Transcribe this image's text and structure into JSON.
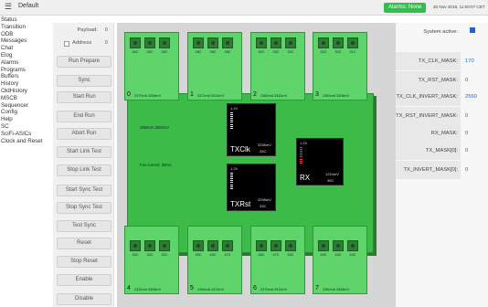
{
  "topbar": {
    "menu_icon": "hamburger-icon",
    "app_title": "Default",
    "alarms": "Alarms: None",
    "datetime": "20 Nov 2019, 11:00:07 CET"
  },
  "sidebar": {
    "items": [
      "Status",
      "Transition",
      "ODB",
      "Messages",
      "Chat",
      "Elog",
      "Alarms",
      "Programs",
      "Buffers",
      "History",
      "OldHistory",
      "MSCB",
      "Sequencer",
      "Config",
      "Help",
      "SC",
      "SciFi-ASICs",
      "Clock and Reset"
    ]
  },
  "controls": {
    "payload_label": "Payload:",
    "payload_value": "0",
    "address_label": "Address",
    "address_value": "0",
    "buttons": [
      "Run Prepare",
      "Sync",
      "Start Run",
      "End Run",
      "Abort Run",
      "Start Link Test",
      "Stop Link Test",
      "Start Sync Test",
      "Stop Sync Test",
      "Test Sync",
      "Reset",
      "Stop Reset",
      "Enable",
      "Disable"
    ]
  },
  "board": {
    "top_modules": [
      {
        "num": "0",
        "temps": [
          "34C",
          "26C",
          "26C"
        ],
        "stats": "2370mA 3308mV"
      },
      {
        "num": "1",
        "temps": [
          "28C",
          "28C",
          "28C"
        ],
        "stats": "2372mA 3312mV"
      },
      {
        "num": "2",
        "temps": [
          "30C",
          "28C",
          "32C"
        ],
        "stats": "2380mA 3332mV"
      },
      {
        "num": "3",
        "temps": [
          "32C",
          "32C",
          "31C"
        ],
        "stats": "2380mA 3308mV"
      }
    ],
    "bottom_modules": [
      {
        "num": "4",
        "temps": [
          "39C",
          "33C",
          "32C"
        ],
        "stats": "2332mA 3308mV"
      },
      {
        "num": "5",
        "temps": [
          "39C",
          "40C",
          "47C"
        ],
        "stats": "2284mA 3312mV"
      },
      {
        "num": "6",
        "temps": [
          "45C",
          "47C",
          "43C"
        ],
        "stats": "2370mA 3312mV"
      },
      {
        "num": "7",
        "temps": [
          "49C",
          "44C",
          "43C"
        ],
        "stats": "2380mA 3308mV"
      }
    ],
    "board_power": "2900mA 3300mV",
    "fan_current": "Fan current: 30mA",
    "txclk": {
      "name": "TXClk",
      "current": "3256mV",
      "temp": "35C",
      "tag": "1.2V"
    },
    "txrst": {
      "name": "TXRst",
      "current": "3298mV",
      "temp": "33C",
      "tag": "1.2V"
    },
    "rx": {
      "name": "RX",
      "current": "1210mV",
      "temp": "35C",
      "tag": "1.2V"
    }
  },
  "right_panel": {
    "system_active_label": "System active:",
    "rows": [
      {
        "label": "TX_CLK_MASK:",
        "value": "170"
      },
      {
        "label": "TX_RST_MASK:",
        "value": "0"
      },
      {
        "label": "TX_CLK_INVERT_MASK:",
        "value": "2560"
      },
      {
        "label": "TX_RST_INVERT_MASK:",
        "value": "0"
      },
      {
        "label": "RX_MASK:",
        "value": "0"
      },
      {
        "label": "TX_MASK[0]:",
        "value": "0"
      },
      {
        "label": "TX_INVERT_MASK[0]:",
        "value": "0"
      }
    ]
  }
}
